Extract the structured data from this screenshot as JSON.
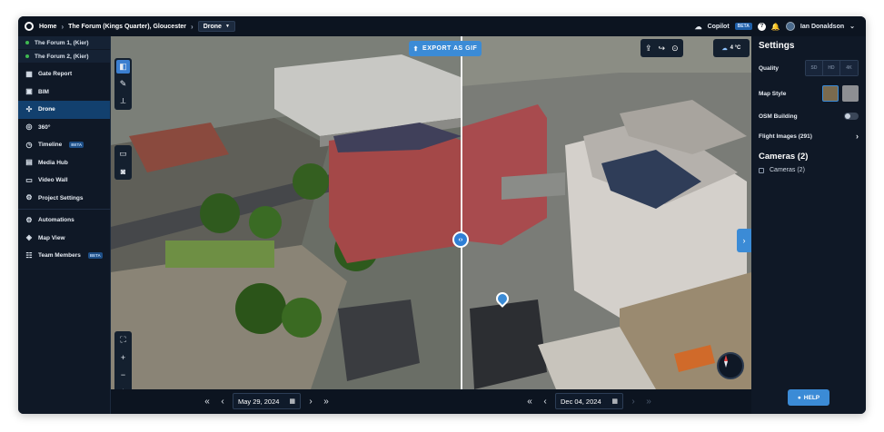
{
  "breadcrumb": {
    "home": "Home",
    "project": "The Forum (Kings Quarter), Gloucester",
    "view": "Drone"
  },
  "topbar": {
    "copilot": "Copilot",
    "copilot_badge": "BETA",
    "user": "Ian Donaldson"
  },
  "sidebar": {
    "projects": [
      "The Forum 1, (Kier)",
      "The Forum 2, (Kier)"
    ],
    "group1": [
      {
        "label": "Gate Report",
        "icon": "gate-icon"
      },
      {
        "label": "BIM",
        "icon": "bim-icon"
      },
      {
        "label": "Drone",
        "icon": "drone-icon",
        "active": true
      },
      {
        "label": "360°",
        "icon": "360-icon"
      },
      {
        "label": "Timeline",
        "icon": "timeline-icon",
        "badge": "BETA"
      },
      {
        "label": "Media Hub",
        "icon": "media-icon"
      },
      {
        "label": "Video Wall",
        "icon": "video-icon"
      },
      {
        "label": "Project Settings",
        "icon": "gear-icon"
      }
    ],
    "group2": [
      {
        "label": "Automations",
        "icon": "automation-icon"
      },
      {
        "label": "Map View",
        "icon": "map-icon"
      },
      {
        "label": "Team Members",
        "icon": "team-icon",
        "badge": "BETA"
      }
    ]
  },
  "map": {
    "export_label": "EXPORT AS GIF",
    "weather": "4 °C",
    "left_date": "May 29, 2024",
    "right_date": "Dec 04, 2024"
  },
  "settings": {
    "title": "Settings",
    "quality_label": "Quality",
    "quality_options": [
      "SD",
      "HD",
      "4K"
    ],
    "map_style_label": "Map Style",
    "osm_label": "OSM Building",
    "flight_images_label": "Flight Images (291)",
    "cameras_title": "Cameras (2)",
    "cameras_item": "Cameras (2)",
    "help_label": "HELP"
  },
  "colors": {
    "accent": "#3b8bd6",
    "active_nav": "#12406e",
    "background": "#0f1826"
  }
}
